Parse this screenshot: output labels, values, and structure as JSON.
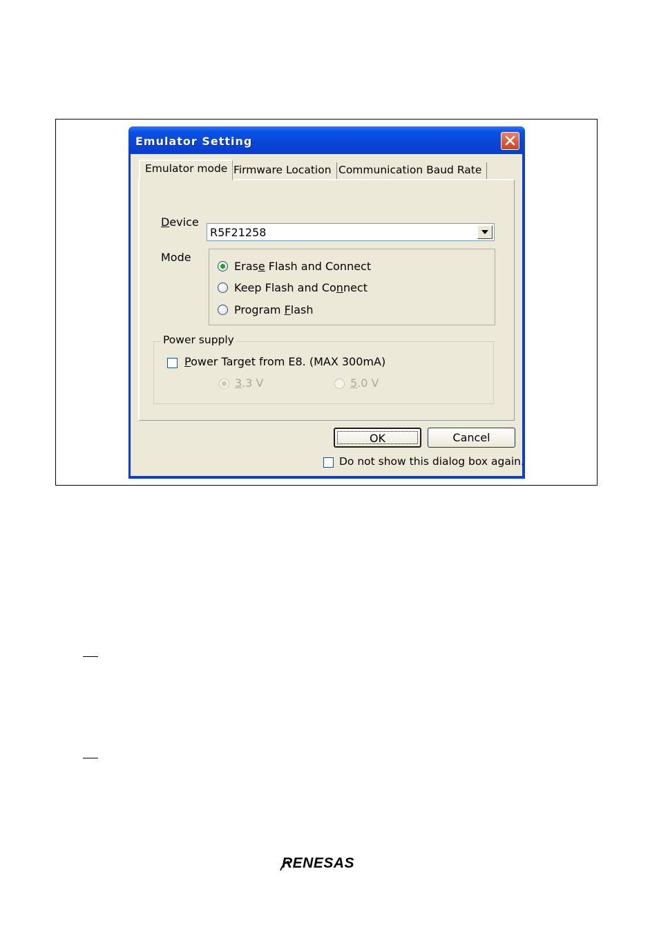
{
  "dialog": {
    "title": "Emulator Setting",
    "tabs": [
      "Emulator mode",
      "Firmware Location",
      "Communication Baud Rate"
    ],
    "device": {
      "label": "Device",
      "value": "R5F21258"
    },
    "mode": {
      "label": "Mode",
      "options": [
        "Erase Flash and Connect",
        "Keep Flash and Connect",
        "Program Flash"
      ],
      "selected": "Erase Flash and Connect"
    },
    "power_supply": {
      "legend": "Power supply",
      "checkbox_label": "Power Target from E8. (MAX 300mA)",
      "checked": false,
      "voltage_options": [
        "3.3 V",
        "5.0 V"
      ],
      "selected_voltage": "3.3 V"
    },
    "ok_label": "OK",
    "cancel_label": "Cancel",
    "dont_show_label": "Do not show this dialog box again.",
    "dont_show_checked": false
  },
  "colors": {
    "title_bar": "#0a52e8",
    "dialog_bg": "#ece9d8",
    "radio_dot": "#21a121",
    "close_button": "#d0401c"
  },
  "footer": {
    "logo_text": "RENESAS"
  }
}
